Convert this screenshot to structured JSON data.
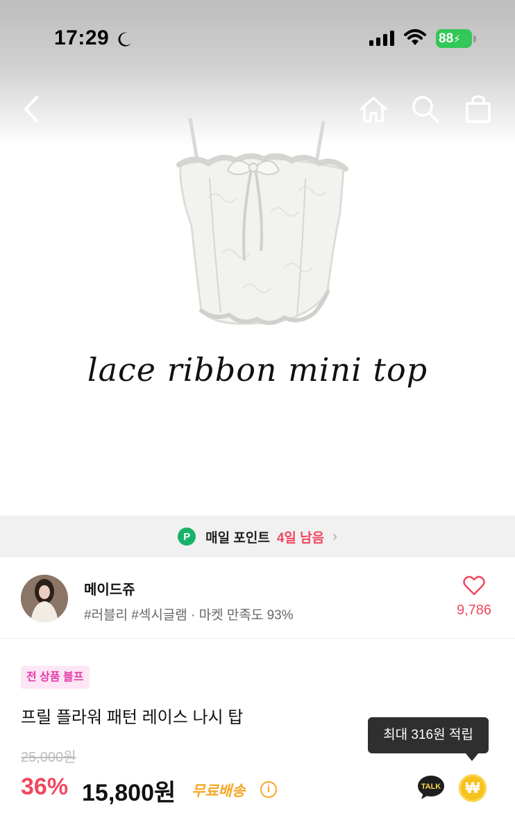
{
  "status_bar": {
    "time": "17:29",
    "battery": "88"
  },
  "nav": {
    "icons": [
      "back-arrow-icon",
      "home-icon",
      "search-icon",
      "shopping-bag-icon"
    ]
  },
  "product_image": {
    "caption": "lace ribbon mini top"
  },
  "points_banner": {
    "badge": "P",
    "label": "매일 포인트",
    "days_left": "4일 남음",
    "chevron": "›"
  },
  "shop": {
    "name": "메이드쥬",
    "tags": "#러블리 #섹시글램 · 마켓 만족도 93%",
    "like_count": "9,786"
  },
  "product": {
    "badge": "전 상품 블프",
    "name": "프릴 플라워 패턴 레이스 나시 탑",
    "original_price": "25,000원",
    "discount": "36%",
    "price": "15,800원",
    "shipping": "무료배송",
    "info_symbol": "i"
  },
  "tooltip": {
    "text": "최대 316원 적립"
  },
  "actions": {
    "talk_label": "TALK",
    "won_symbol": "₩"
  },
  "colors": {
    "accent_pink": "#f0485f",
    "point_green": "#17b26a",
    "ship_orange": "#f5a623",
    "coin_yellow": "#f6c21c"
  }
}
